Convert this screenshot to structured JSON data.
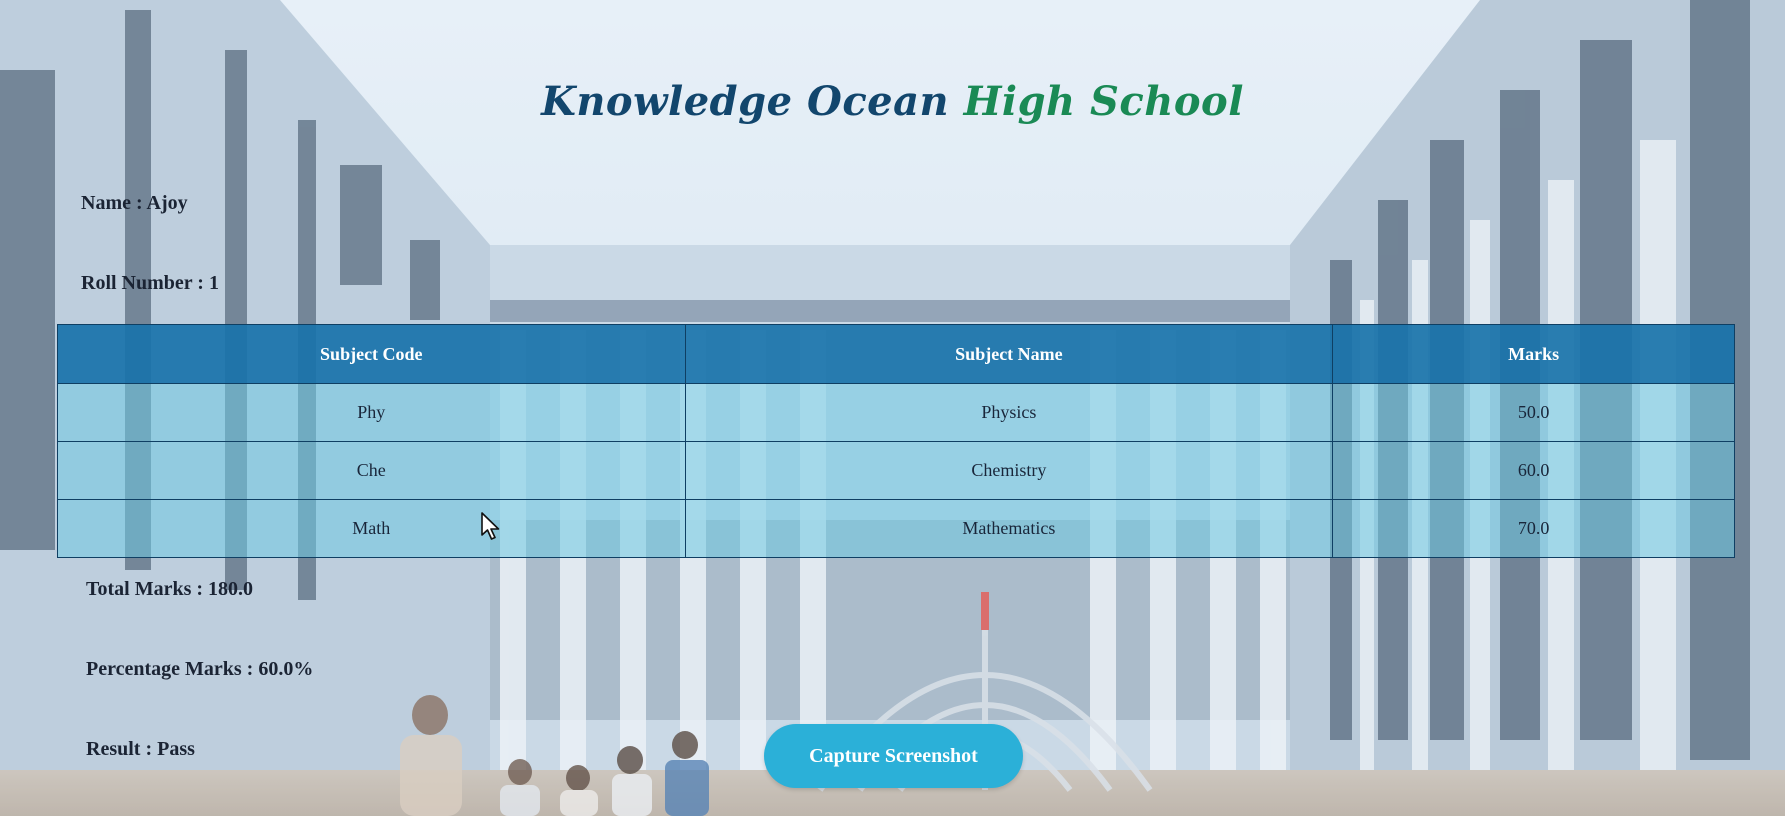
{
  "school": {
    "title_part1": "Knowledge Ocean",
    "title_part2": "High School"
  },
  "student": {
    "name_line": "Name : Ajoy",
    "roll_line": "Roll Number : 1"
  },
  "table": {
    "headers": [
      "Subject Code",
      "Subject Name",
      "Marks"
    ],
    "rows": [
      {
        "code": "Phy",
        "name": "Physics",
        "marks": "50.0"
      },
      {
        "code": "Che",
        "name": "Chemistry",
        "marks": "60.0"
      },
      {
        "code": "Math",
        "name": "Mathematics",
        "marks": "70.0"
      }
    ]
  },
  "summary": {
    "total_line": "Total Marks : 180.0",
    "percentage_line": "Percentage Marks : 60.0%",
    "result_line": "Result : Pass"
  },
  "actions": {
    "capture_label": "Capture Screenshot"
  },
  "colors": {
    "title_blue": "#12466d",
    "title_green": "#1a8a55",
    "header_bg": "#1973aa",
    "button_bg": "#2bb0d8"
  },
  "icons": {
    "pointer": "mouse-pointer-icon"
  }
}
